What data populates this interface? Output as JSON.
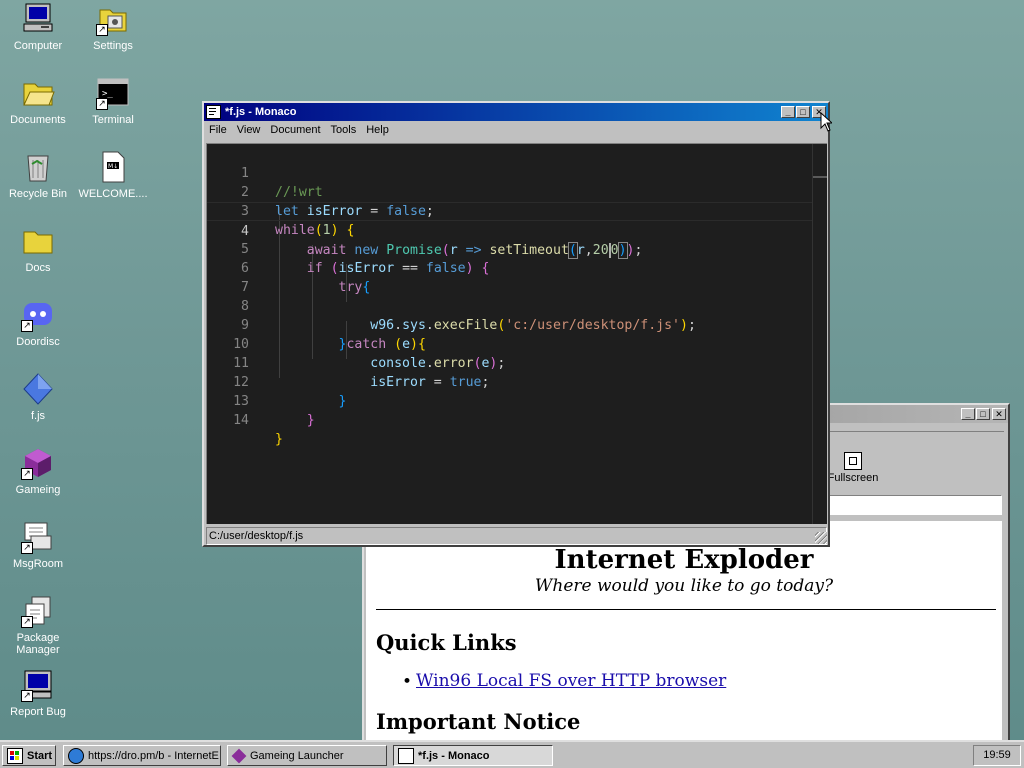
{
  "desktop": {
    "icons": [
      {
        "label": "Computer",
        "icon": "computer-icon"
      },
      {
        "label": "Settings",
        "icon": "settings-icon"
      },
      {
        "label": "Documents",
        "icon": "folder-open-icon"
      },
      {
        "label": "Terminal",
        "icon": "terminal-icon"
      },
      {
        "label": "Recycle Bin",
        "icon": "recycle-bin-icon"
      },
      {
        "label": "WELCOME....",
        "icon": "document-icon"
      },
      {
        "label": "Docs",
        "icon": "folder-icon"
      },
      {
        "label": "Doordisc",
        "icon": "doordisc-icon"
      },
      {
        "label": "f.js",
        "icon": "js-file-icon"
      },
      {
        "label": "Gameing",
        "icon": "cube-icon"
      },
      {
        "label": "MsgRoom",
        "icon": "msgroom-icon"
      },
      {
        "label": "Package Manager",
        "icon": "package-icon"
      },
      {
        "label": "Report Bug",
        "icon": "report-bug-icon"
      }
    ]
  },
  "editor_window": {
    "title": "*f.js - Monaco",
    "menu": [
      "File",
      "View",
      "Document",
      "Tools",
      "Help"
    ],
    "status_path": "C:/user/desktop/f.js",
    "current_line": 4,
    "lines": [
      {
        "n": "1",
        "text": "//!wrt"
      },
      {
        "n": "2",
        "text": "let isError = false;"
      },
      {
        "n": "3",
        "text": "while(1) {"
      },
      {
        "n": "4",
        "text": "    await new Promise(r => setTimeout(r,200));"
      },
      {
        "n": "5",
        "text": "    if (isError == false) {"
      },
      {
        "n": "6",
        "text": "        try{"
      },
      {
        "n": "7",
        "text": ""
      },
      {
        "n": "8",
        "text": "            w96.sys.execFile('c:/user/desktop/f.js');"
      },
      {
        "n": "9",
        "text": "        }catch (e){"
      },
      {
        "n": "10",
        "text": "            console.error(e);"
      },
      {
        "n": "11",
        "text": "            isError = true;"
      },
      {
        "n": "12",
        "text": "        }"
      },
      {
        "n": "13",
        "text": "    }"
      },
      {
        "n": "14",
        "text": "}"
      }
    ]
  },
  "browser_window": {
    "toolbar_fullscreen_label": "Fullscreen",
    "heading": "Internet Exploder",
    "tagline": "Where would you like to go today?",
    "quick_links_heading": "Quick Links",
    "link_label": "Win96 Local FS over HTTP browser",
    "notice_heading": "Important Notice"
  },
  "taskbar": {
    "start_label": "Start",
    "tasks": [
      {
        "label": "https://dro.pm/b - InternetE",
        "icon": "globe-icon"
      },
      {
        "label": "Gameing Launcher",
        "icon": "cube-icon"
      },
      {
        "label": "*f.js - Monaco",
        "icon": "editor-icon"
      }
    ],
    "clock": "19:59"
  },
  "colors": {
    "desktop_bg": "#6f9896",
    "titlebar_active": "#000080",
    "editor_bg": "#1e1e1e"
  }
}
